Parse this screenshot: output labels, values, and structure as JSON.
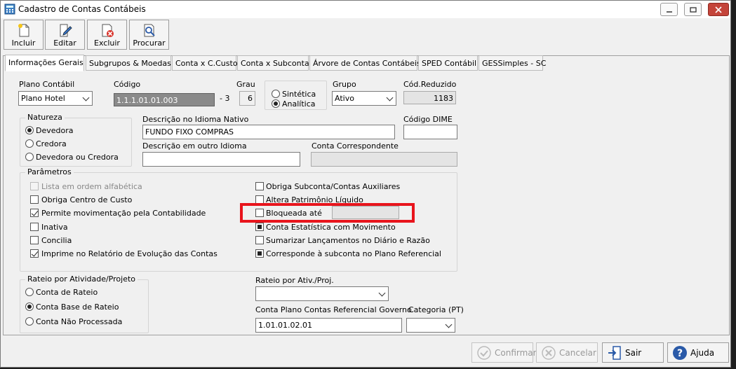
{
  "window": {
    "title": "Cadastro de Contas Contábeis"
  },
  "toolbar": {
    "incluir": "Incluir",
    "editar": "Editar",
    "excluir": "Excluir",
    "procurar": "Procurar"
  },
  "tabs": [
    "Informações Gerais",
    "Subgrupos & Moedas",
    "Conta x C.Custo",
    "Conta x Subconta",
    "Árvore de Contas Contábeis",
    "SPED Contábil",
    "GESSimples - SC"
  ],
  "form": {
    "plano_label": "Plano Contábil",
    "plano_value": "Plano Hotel",
    "codigo_label": "Código",
    "codigo_value": "1.1.1.01.01.003",
    "codigo_suffix": "- 3",
    "grau_label": "Grau",
    "grau_value": "6",
    "sintetica": "Sintética",
    "analitica": "Analítica",
    "grupo_label": "Grupo",
    "grupo_value": "Ativo",
    "codred_label": "Cód.Reduzido",
    "codred_value": "1183",
    "natureza_title": "Natureza",
    "devedora": "Devedora",
    "credora": "Credora",
    "devedora_credora": "Devedora ou Credora",
    "desc_nativo_label": "Descrição no Idioma Nativo",
    "desc_nativo_value": "FUNDO FIXO COMPRAS",
    "dime_label": "Código DIME",
    "dime_value": "",
    "desc_outro_label": "Descrição em outro Idioma",
    "desc_outro_value": "",
    "correspondente_label": "Conta Correspondente",
    "correspondente_value": "",
    "parametros_title": "Parâmetros",
    "p_lista": "Lista em ordem alfabética",
    "p_centro": "Obriga Centro de Custo",
    "p_permite": "Permite movimentação pela Contabilidade",
    "p_inativa": "Inativa",
    "p_concilia": "Concilia",
    "p_imprime": "Imprime no Relatório de Evolução das Contas",
    "p_subconta": "Obriga Subconta/Contas Auxiliares",
    "p_altera": "Altera Patrimônio Líquido",
    "p_bloqueada": "Bloqueada até",
    "p_estatistica": "Conta Estatística com Movimento",
    "p_sumarizar": "Sumarizar Lançamentos no Diário e Razão",
    "p_corresponde": "Corresponde à subconta no Plano Referencial",
    "rateio_title": "Rateio por Atividade/Projeto",
    "r_conta_rateio": "Conta de Rateio",
    "r_base": "Conta Base de Rateio",
    "r_nao": "Conta Não Processada",
    "rateio_ativ_label": "Rateio por Ativ./Proj.",
    "rateio_ativ_value": "",
    "ref_label": "Conta Plano Contas Referencial Governo",
    "ref_value": "1.01.01.02.01",
    "categoria_label": "Categoria (PT)",
    "categoria_value": ""
  },
  "buttons": {
    "confirmar": "Confirmar",
    "cancelar": "Cancelar",
    "sair": "Sair",
    "ajuda": "Ajuda"
  },
  "colors": {
    "highlight": "#e8141c"
  }
}
